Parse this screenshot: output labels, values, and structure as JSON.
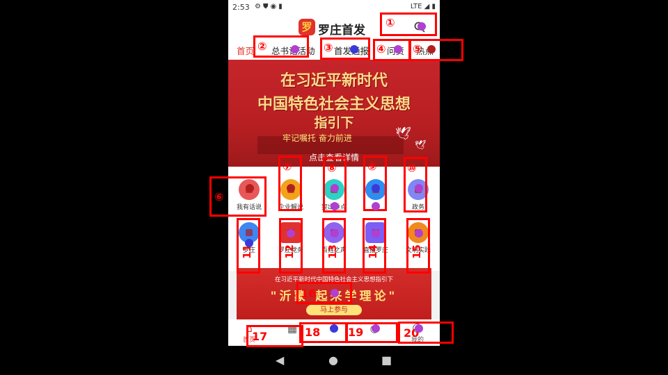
{
  "status_bar": {
    "time": "2:53",
    "network": "LTE"
  },
  "app": {
    "title": "罗庄首发",
    "logo_text": "罗"
  },
  "tabs": [
    "首页",
    "总书记活动",
    "首发通报",
    "问责",
    "热点"
  ],
  "banner": {
    "line1": "在习近平新时代",
    "line2": "中国特色社会主义思想",
    "line3": "指引下",
    "slogan": "牢记嘱托    奋力前进",
    "cta": "点击查看详情"
  },
  "grid_row1": [
    "我有话说",
    "企业解说",
    "突出重点",
    "",
    "政务"
  ],
  "grid_row2": [
    "罗庄",
    "罗庄党务",
    "百姓之声",
    "直播罗庄",
    "文明实践"
  ],
  "promo": {
    "line1": "在习近平新时代中国特色社会主义思想指引下",
    "line2": "\"沂蒙 起来学理论\"",
    "button": "马上参与"
  },
  "bottom_nav": [
    "首页",
    "",
    "",
    "我的"
  ],
  "annotations": [
    "①",
    "②",
    "③",
    "④",
    "⑤",
    "⑥",
    "⑦",
    "⑧",
    "⑨",
    "⑩",
    "11",
    "12",
    "13",
    "14",
    "15",
    "16",
    "17",
    "18",
    "19",
    "20"
  ],
  "colors": {
    "brand_red": "#e0332c",
    "annotation_red": "#ff0000",
    "dot_purple": "#b040d0",
    "dot_blue": "#3a3ad8",
    "dot_darkred": "#b02020"
  },
  "icons": {
    "grid_row1": [
      "#e85858",
      "#f3a21b",
      "#2dd1c6",
      "#2f8cf0",
      "#7f86f5"
    ],
    "grid_row2": [
      "#3e86f0",
      "#e03131",
      "#8f63f0",
      "#7a5ef5",
      "#f08a1e"
    ]
  }
}
